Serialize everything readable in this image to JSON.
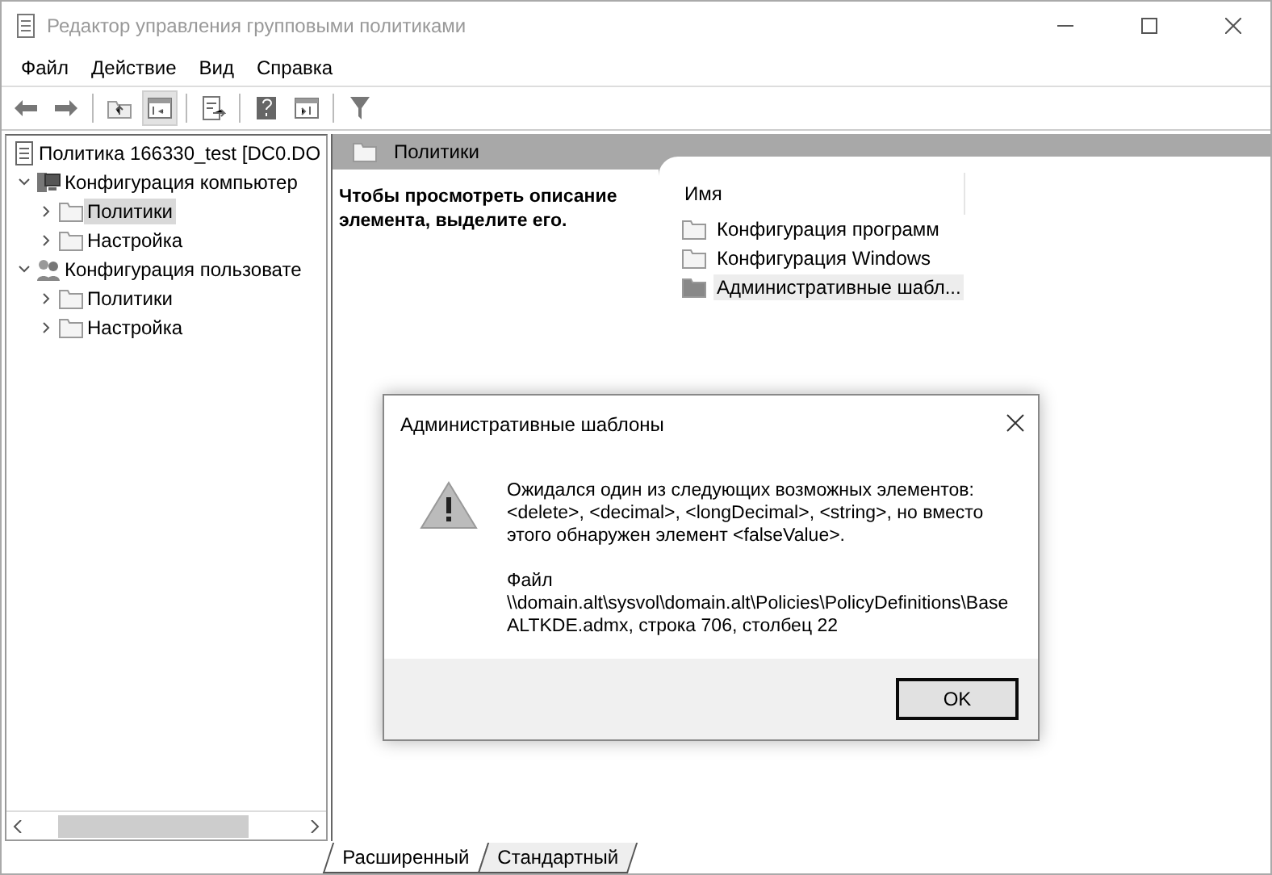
{
  "window": {
    "title": "Редактор управления групповыми политиками"
  },
  "menu": [
    "Файл",
    "Действие",
    "Вид",
    "Справка"
  ],
  "toolbar": [
    {
      "kind": "back",
      "pressed": false
    },
    {
      "kind": "forward",
      "pressed": false
    },
    {
      "kind": "sep"
    },
    {
      "kind": "up",
      "pressed": false
    },
    {
      "kind": "tree",
      "pressed": true
    },
    {
      "kind": "sep"
    },
    {
      "kind": "export",
      "pressed": false
    },
    {
      "kind": "sep"
    },
    {
      "kind": "help",
      "pressed": false
    },
    {
      "kind": "pane",
      "pressed": false
    },
    {
      "kind": "sep"
    },
    {
      "kind": "filter",
      "pressed": false
    }
  ],
  "tree": [
    {
      "label": "Политика 166330_test [DC0.DO",
      "kind": "policy",
      "children": [
        {
          "label": "Конфигурация компьютер",
          "kind": "computer",
          "expanded": true,
          "selected": false,
          "children": [
            {
              "label": "Политики",
              "kind": "folder",
              "expanded": false,
              "selected": true
            },
            {
              "label": "Настройка",
              "kind": "folder",
              "expanded": false,
              "selected": false
            }
          ]
        },
        {
          "label": "Конфигурация пользовате",
          "kind": "users",
          "expanded": true,
          "selected": false,
          "children": [
            {
              "label": "Политики",
              "kind": "folder",
              "expanded": false,
              "selected": false
            },
            {
              "label": "Настройка",
              "kind": "folder",
              "expanded": false,
              "selected": false
            }
          ]
        }
      ]
    }
  ],
  "details": {
    "header": "Политики",
    "description": "Чтобы просмотреть описание элемента, выделите его.",
    "column": "Имя",
    "items": [
      {
        "label": "Конфигурация программ",
        "kind": "folder",
        "selected": false
      },
      {
        "label": "Конфигурация Windows",
        "kind": "folder",
        "selected": false
      },
      {
        "label": "Административные шабл...",
        "kind": "template",
        "selected": true
      }
    ]
  },
  "view_tabs": [
    {
      "label": "Расширенный",
      "selected": true
    },
    {
      "label": "Стандартный",
      "selected": false
    }
  ],
  "dialog": {
    "title": "Административные шаблоны",
    "message": "Ожидался один из следующих возможных элементов: <delete>, <decimal>, <longDecimal>, <string>, но вместо этого обнаружен элемент <falseValue>.",
    "file_label": "Файл",
    "file_lines": [
      "\\\\domain.alt\\sysvol\\domain.alt\\Policies\\PolicyDefinitions\\Base",
      "ALTKDE.admx, строка 706, столбец 22"
    ],
    "button": "OK"
  }
}
